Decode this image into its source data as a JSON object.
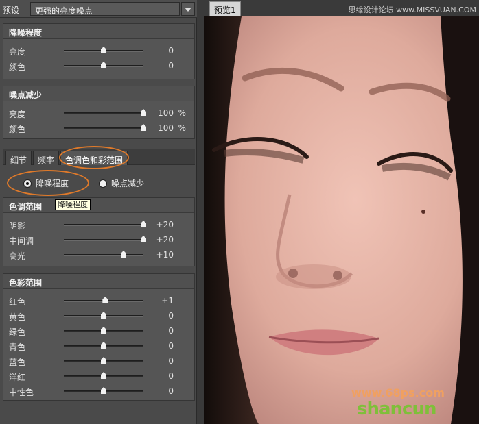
{
  "preset": {
    "label": "预设",
    "value": "更强的亮度噪点"
  },
  "noise_reduction": {
    "title": "降噪程度",
    "rows": [
      {
        "label": "亮度",
        "value": "0",
        "unit": "",
        "level": 0.5
      },
      {
        "label": "颜色",
        "value": "0",
        "unit": "",
        "level": 0.5
      }
    ]
  },
  "noise_reduce": {
    "title": "噪点减少",
    "rows": [
      {
        "label": "亮度",
        "value": "100",
        "unit": "%",
        "level": 1.0
      },
      {
        "label": "颜色",
        "value": "100",
        "unit": "%",
        "level": 1.0
      }
    ]
  },
  "tabs": [
    {
      "label": "细节",
      "active": false
    },
    {
      "label": "频率",
      "active": false
    },
    {
      "label": "色调色和彩范围",
      "active": true
    }
  ],
  "radios": [
    {
      "label": "降噪程度",
      "selected": true
    },
    {
      "label": "噪点减少",
      "selected": false
    }
  ],
  "tone_range": {
    "title": "色调范围",
    "tooltip": "降噪程度",
    "rows": [
      {
        "label": "阴影",
        "value": "+20",
        "level": 1.0
      },
      {
        "label": "中间调",
        "value": "+20",
        "level": 1.0
      },
      {
        "label": "高光",
        "value": "+10",
        "level": 0.75
      }
    ]
  },
  "color_range": {
    "title": "色彩范围",
    "rows": [
      {
        "label": "红色",
        "value": "+1",
        "level": 0.52
      },
      {
        "label": "黄色",
        "value": "0",
        "level": 0.5
      },
      {
        "label": "绿色",
        "value": "0",
        "level": 0.5
      },
      {
        "label": "青色",
        "value": "0",
        "level": 0.5
      },
      {
        "label": "蓝色",
        "value": "0",
        "level": 0.5
      },
      {
        "label": "洋红",
        "value": "0",
        "level": 0.5
      },
      {
        "label": "中性色",
        "value": "0",
        "level": 0.5
      }
    ]
  },
  "preview": {
    "tab_label": "预览1",
    "watermark_top": "思缘设计论坛 www.MISSVUAN.COM",
    "site_a": "www.68ps.com",
    "site_b": "shancun"
  },
  "colors": {
    "accent": "#e07a2a",
    "panel": "#4a4a4a"
  }
}
